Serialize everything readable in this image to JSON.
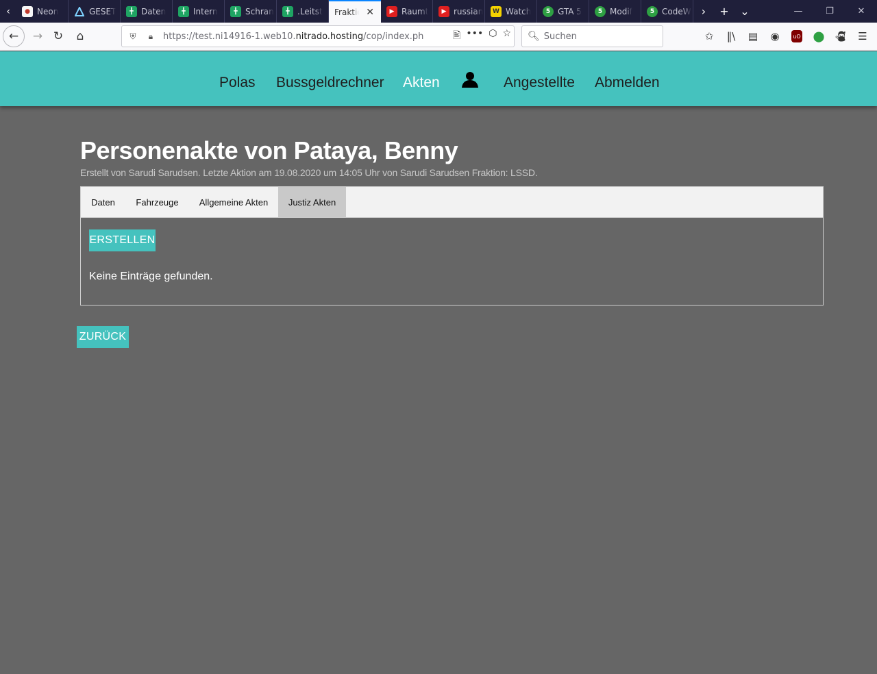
{
  "browser": {
    "tabs": [
      {
        "title": "Neon",
        "icon": "neon-favicon",
        "active": false
      },
      {
        "title": "GESET",
        "icon": "triangle-favicon",
        "active": false
      },
      {
        "title": "Daten",
        "icon": "sheets-favicon",
        "active": false
      },
      {
        "title": "Intern",
        "icon": "sheets-favicon",
        "active": false
      },
      {
        "title": "Schran",
        "icon": "sheets-favicon",
        "active": false
      },
      {
        "title": ".Leitst",
        "icon": "sheets-favicon",
        "active": false
      },
      {
        "title": "Fraktio",
        "icon": "",
        "active": true
      },
      {
        "title": "Raumt",
        "icon": "youtube-favicon",
        "active": false
      },
      {
        "title": "russian",
        "icon": "youtube-favicon",
        "active": false
      },
      {
        "title": "Watch",
        "icon": "w-favicon",
        "active": false
      },
      {
        "title": "GTA 5",
        "icon": "green-circle-favicon",
        "active": false
      },
      {
        "title": "Modif",
        "icon": "green-circle-favicon",
        "active": false
      },
      {
        "title": "CodeW",
        "icon": "green-circle-favicon",
        "active": false
      }
    ],
    "url_prefix": "https://test.ni14916-1.web10.",
    "url_domain": "nitrado.hosting",
    "url_suffix": "/cop/index.php?site",
    "search_placeholder": "Suchen"
  },
  "site_nav": {
    "items": [
      {
        "label": "Polas",
        "active": false
      },
      {
        "label": "Bussgeldrechner",
        "active": false
      },
      {
        "label": "Akten",
        "active": true
      },
      {
        "label": "Angestellte",
        "active": false
      },
      {
        "label": "Abmelden",
        "active": false
      }
    ]
  },
  "page": {
    "title": "Personenakte von Pataya, Benny",
    "subtitle": "Erstellt von Sarudi Sarudsen. Letzte Aktion am 19.08.2020 um 14:05 Uhr von Sarudi Sarudsen Fraktion: LSSD.",
    "tabs": [
      {
        "label": "Daten",
        "active": false
      },
      {
        "label": "Fahrzeuge",
        "active": false
      },
      {
        "label": "Allgemeine Akten",
        "active": false
      },
      {
        "label": "Justiz Akten",
        "active": true
      }
    ],
    "create_button": "ERSTELLEN",
    "empty_message": "Keine Einträge gefunden.",
    "back_button": "ZURÜCK"
  },
  "colors": {
    "accent": "#45c2be",
    "page_background": "#666666",
    "tab_bar": "#1f1f3a"
  }
}
